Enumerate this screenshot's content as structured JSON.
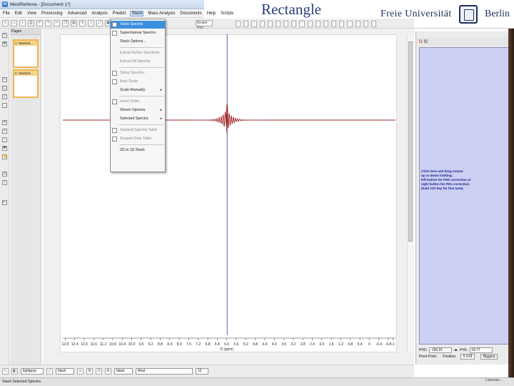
{
  "window": {
    "title": "MestReNova - [Document 1*]"
  },
  "menubar": {
    "items": [
      "File",
      "Edit",
      "View",
      "Processing",
      "Advanced",
      "Analysis",
      "Predict",
      "Stack",
      "Mass Analysis",
      "Documents",
      "Help",
      "Scripts"
    ],
    "active": "Stack"
  },
  "slide": {
    "title": "Rectangle"
  },
  "logo": {
    "left_text": "Freie Universität",
    "right_text": "Berlin"
  },
  "toolbar": {
    "select_value": "Bruker Pos"
  },
  "pages_panel": {
    "header": "Pages",
    "thumbs": [
      "1. Stacked...",
      "2. Stacked..."
    ]
  },
  "stack_menu": {
    "items": [
      {
        "label": "Stack Spectra",
        "state": "highlight"
      },
      {
        "label": "Superimpose Spectra",
        "state": "normal"
      },
      {
        "label": "Stack Options...",
        "state": "normal"
      },
      {
        "label": "Extract Active Spectrum",
        "state": "disabled"
      },
      {
        "label": "Extract All Spectra",
        "state": "disabled"
      },
      {
        "label": "Setup Spectra...",
        "state": "disabled"
      },
      {
        "label": "Auto Scale",
        "state": "disabled"
      },
      {
        "label": "Scale Manually",
        "state": "normal",
        "submenu": true
      },
      {
        "label": "Invert Order",
        "state": "disabled"
      },
      {
        "label": "Shown Spectra",
        "state": "normal",
        "submenu": true
      },
      {
        "label": "Selected Spectra",
        "state": "normal",
        "submenu": true
      },
      {
        "label": "Stacked Spectra Table",
        "state": "disabled"
      },
      {
        "label": "Arrayed Data Table",
        "state": "disabled"
      },
      {
        "label": "2D to 1D Stack",
        "state": "normal"
      }
    ]
  },
  "axis": {
    "ticks": [
      "12.8",
      "12.4",
      "12.0",
      "11.6",
      "11.2",
      "10.8",
      "10.4",
      "10.0",
      "9.6",
      "9.2",
      "8.8",
      "8.4",
      "8.0",
      "7.6",
      "7.2",
      "6.8",
      "6.4",
      "6.0",
      "5.6",
      "5.2",
      "4.8",
      "4.4",
      "4.0",
      "3.6",
      "3.2",
      "2.8",
      "2.4",
      "2.0",
      "1.6",
      "1.2",
      "0.8",
      "0.4",
      "0",
      "-0.4",
      "-0.8",
      "-1"
    ],
    "label": "f1 (ppm)",
    "range": [
      12.9,
      -1.1
    ]
  },
  "spectrum": {
    "peak_ppm": 6.0,
    "color": "#a32a2a",
    "cursor_color": "#2d3f8f"
  },
  "right_panel": {
    "tabs": [
      "f1",
      "f2"
    ],
    "instructions": [
      "Click here and drag mouse",
      "up or down holding:",
      "left button for PH0 correction or",
      "right button for PH1 correction.",
      "(hold Ctrl key for fine tune)"
    ],
    "ph0_label": "PH0:",
    "ph0_value": "-166.91",
    "ph1_label": "PH1:",
    "ph1_value": "18.77",
    "pivot_label": "Pivot Point",
    "position_label": "Position:",
    "position_value": "5.918",
    "biggest_label": "Biggest",
    "box_color": "#ccd0f2"
  },
  "bottom_toolbar": {
    "color_value": "lightgray",
    "line1": "black",
    "line2": "black",
    "font": "Arial",
    "size": "12"
  },
  "status": {
    "text": "Stack Selected Spectra",
    "license": "Licenses..."
  }
}
